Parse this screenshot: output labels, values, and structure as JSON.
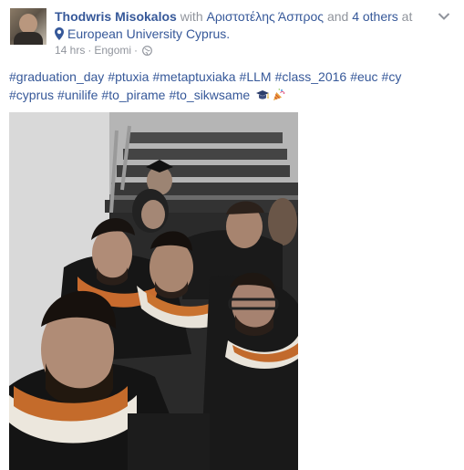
{
  "post": {
    "author": "Thodwris Misokalos",
    "with_word": "with",
    "tagged_person": "Αριστοτέλης Άσπρος",
    "and_word": "and",
    "others": "4 others",
    "at_word": "at",
    "location": "European University Cyprus.",
    "time": "14 hrs",
    "place": "Engomi",
    "privacy_icon": "globe-icon",
    "menu_icon": "chevron-down-icon",
    "hashtags": [
      "#graduation_day",
      "#ptuxia",
      "#metaptuxiaka",
      "#LLM",
      "#class_2016",
      "#euc",
      "#cy",
      "#cyprus",
      "#unilife",
      "#to_pirame",
      "#to_sikwsame"
    ],
    "emojis": [
      "graduation-cap-icon",
      "party-popper-icon"
    ]
  },
  "colors": {
    "link": "#365899",
    "muted": "#90949c",
    "text": "#1d2129"
  }
}
